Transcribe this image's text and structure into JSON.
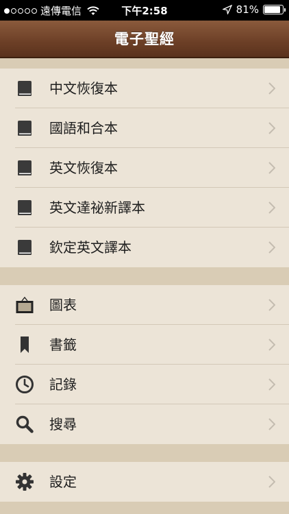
{
  "status_bar": {
    "carrier": "遠傳電信",
    "time": "下午2:58",
    "battery": "81%",
    "battery_level": 0.81
  },
  "nav": {
    "title": "電子聖經"
  },
  "sections": [
    {
      "items": [
        {
          "label": "中文恢復本",
          "icon": "book-icon"
        },
        {
          "label": "國語和合本",
          "icon": "book-icon"
        },
        {
          "label": "英文恢復本",
          "icon": "book-icon"
        },
        {
          "label": "英文達祕新譯本",
          "icon": "book-icon"
        },
        {
          "label": "欽定英文譯本",
          "icon": "book-icon"
        }
      ]
    },
    {
      "items": [
        {
          "label": "圖表",
          "icon": "picture-frame-icon"
        },
        {
          "label": "書籤",
          "icon": "bookmark-icon"
        },
        {
          "label": "記錄",
          "icon": "clock-icon"
        },
        {
          "label": "搜尋",
          "icon": "search-icon"
        }
      ]
    },
    {
      "items": [
        {
          "label": "設定",
          "icon": "gear-icon"
        }
      ]
    }
  ]
}
